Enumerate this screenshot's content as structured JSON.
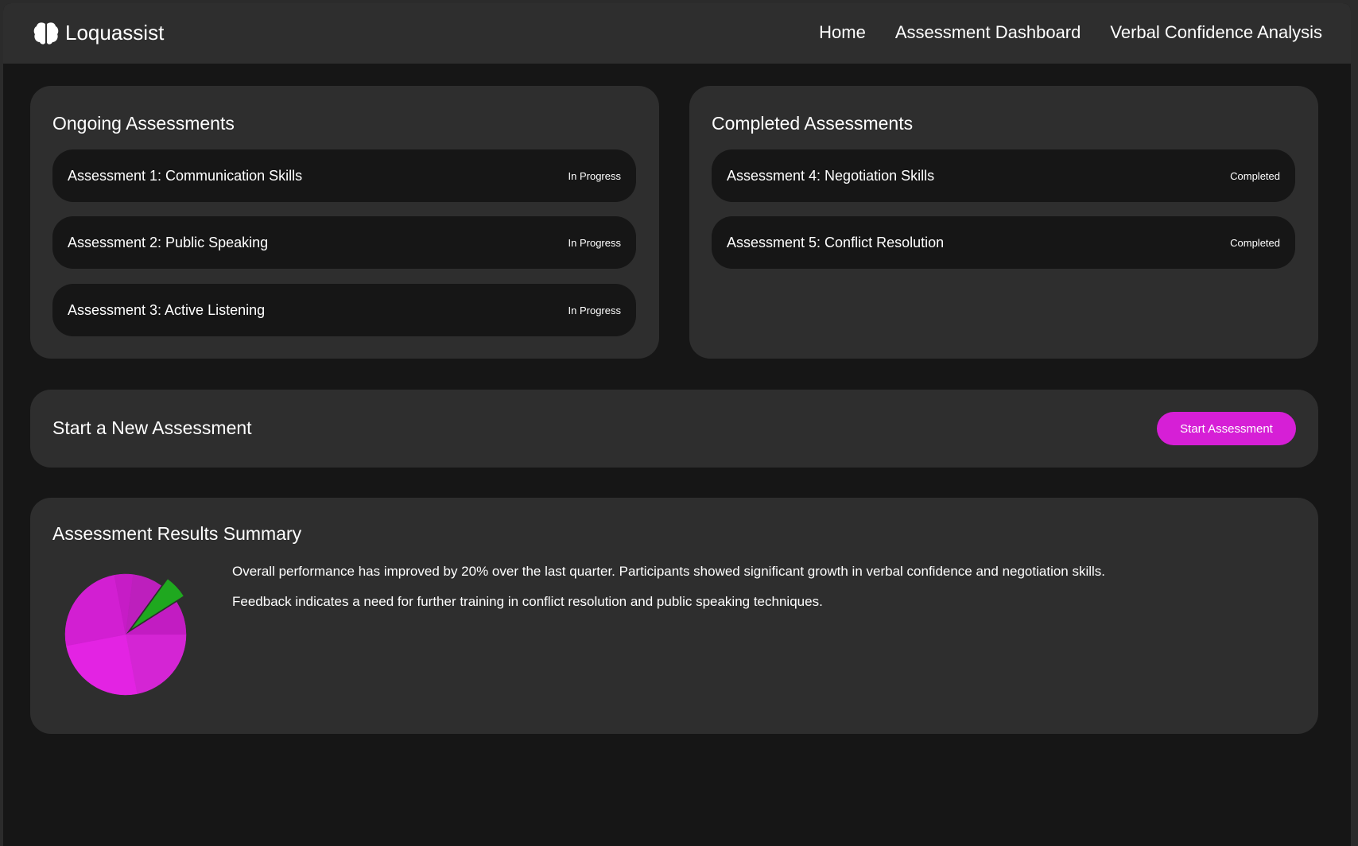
{
  "header": {
    "app_name": "Loquassist",
    "logo_icon": "brain-icon",
    "nav": [
      {
        "label": "Home"
      },
      {
        "label": "Assessment Dashboard"
      },
      {
        "label": "Verbal Confidence Analysis"
      }
    ]
  },
  "ongoing": {
    "title": "Ongoing Assessments",
    "items": [
      {
        "label": "Assessment 1: Communication Skills",
        "status": "In Progress"
      },
      {
        "label": "Assessment 2: Public Speaking",
        "status": "In Progress"
      },
      {
        "label": "Assessment 3: Active Listening",
        "status": "In Progress"
      }
    ]
  },
  "completed": {
    "title": "Completed Assessments",
    "items": [
      {
        "label": "Assessment 4: Negotiation Skills",
        "status": "Completed"
      },
      {
        "label": "Assessment 5: Conflict Resolution",
        "status": "Completed"
      }
    ]
  },
  "new_assessment": {
    "title": "Start a New Assessment",
    "button_label": "Start Assessment"
  },
  "summary": {
    "title": "Assessment Results Summary",
    "paragraphs": [
      "Overall performance has improved by 20% over the last quarter. Participants showed significant growth in verbal confidence and negotiation skills.",
      "Feedback indicates a need for further training in conflict resolution and public speaking techniques."
    ]
  },
  "colors": {
    "accent": "#d61fd6",
    "background": "#161616",
    "panel": "#2e2e2e",
    "highlight": "#1fa81f"
  },
  "chart_data": {
    "type": "pie",
    "values": [
      22,
      25,
      25,
      5,
      8,
      6,
      9
    ],
    "colors": [
      "#d425d4",
      "#e323e3",
      "#d21fd2",
      "#c61cc6",
      "#bd1fbd",
      "#1fa81f",
      "#c21cc2"
    ],
    "explode": [
      0,
      0,
      0,
      0,
      0,
      0.15,
      0
    ]
  }
}
